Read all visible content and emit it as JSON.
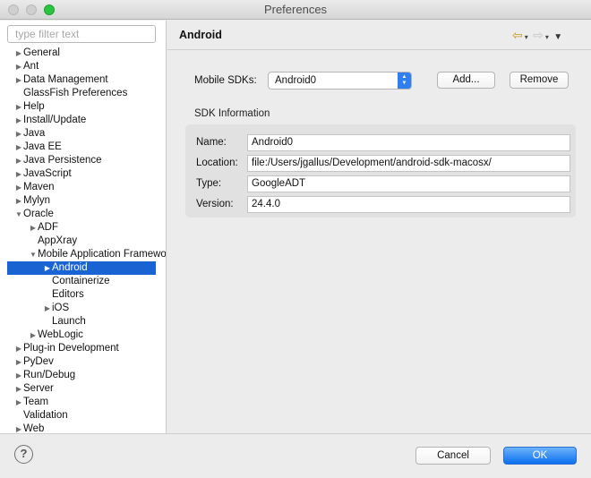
{
  "window": {
    "title": "Preferences"
  },
  "filter": {
    "placeholder": "type filter text"
  },
  "tree": [
    {
      "label": "General",
      "twisty": "▶"
    },
    {
      "label": "Ant",
      "twisty": "▶"
    },
    {
      "label": "Data Management",
      "twisty": "▶"
    },
    {
      "label": "GlassFish Preferences",
      "twisty": ""
    },
    {
      "label": "Help",
      "twisty": "▶"
    },
    {
      "label": "Install/Update",
      "twisty": "▶"
    },
    {
      "label": "Java",
      "twisty": "▶"
    },
    {
      "label": "Java EE",
      "twisty": "▶"
    },
    {
      "label": "Java Persistence",
      "twisty": "▶"
    },
    {
      "label": "JavaScript",
      "twisty": "▶"
    },
    {
      "label": "Maven",
      "twisty": "▶"
    },
    {
      "label": "Mylyn",
      "twisty": "▶"
    },
    {
      "label": "Oracle",
      "twisty": "▼"
    },
    {
      "label": "ADF",
      "twisty": "▶"
    },
    {
      "label": "AppXray",
      "twisty": ""
    },
    {
      "label": "Mobile Application Framework",
      "twisty": "▼"
    },
    {
      "label": "Android",
      "twisty": "▶"
    },
    {
      "label": "Containerize",
      "twisty": ""
    },
    {
      "label": "Editors",
      "twisty": ""
    },
    {
      "label": "iOS",
      "twisty": "▶"
    },
    {
      "label": "Launch",
      "twisty": ""
    },
    {
      "label": "WebLogic",
      "twisty": "▶"
    },
    {
      "label": "Plug-in Development",
      "twisty": "▶"
    },
    {
      "label": "PyDev",
      "twisty": "▶"
    },
    {
      "label": "Run/Debug",
      "twisty": "▶"
    },
    {
      "label": "Server",
      "twisty": "▶"
    },
    {
      "label": "Team",
      "twisty": "▶"
    },
    {
      "label": "Validation",
      "twisty": ""
    },
    {
      "label": "Web",
      "twisty": "▶"
    }
  ],
  "page": {
    "title": "Android",
    "nav": {
      "back_glyph": "⇦",
      "forward_glyph": "⇨",
      "dropdown_glyph": "▾",
      "menu_glyph": "▼"
    }
  },
  "sdk": {
    "label": "Mobile SDKs:",
    "selected": "Android0",
    "add_label": "Add...",
    "remove_label": "Remove"
  },
  "info": {
    "title": "SDK Information",
    "fields": [
      {
        "label": "Name:",
        "value": "Android0"
      },
      {
        "label": "Location:",
        "value": "file:/Users/jgallus/Development/android-sdk-macosx/"
      },
      {
        "label": "Type:",
        "value": "GoogleADT"
      },
      {
        "label": "Version:",
        "value": "24.4.0"
      }
    ]
  },
  "footer": {
    "help_glyph": "?",
    "cancel_label": "Cancel",
    "ok_label": "OK"
  },
  "colors": {
    "selection": "#1a63d3",
    "ok_button": "#0d6ff0",
    "select_arrows": "#2f80ee"
  }
}
